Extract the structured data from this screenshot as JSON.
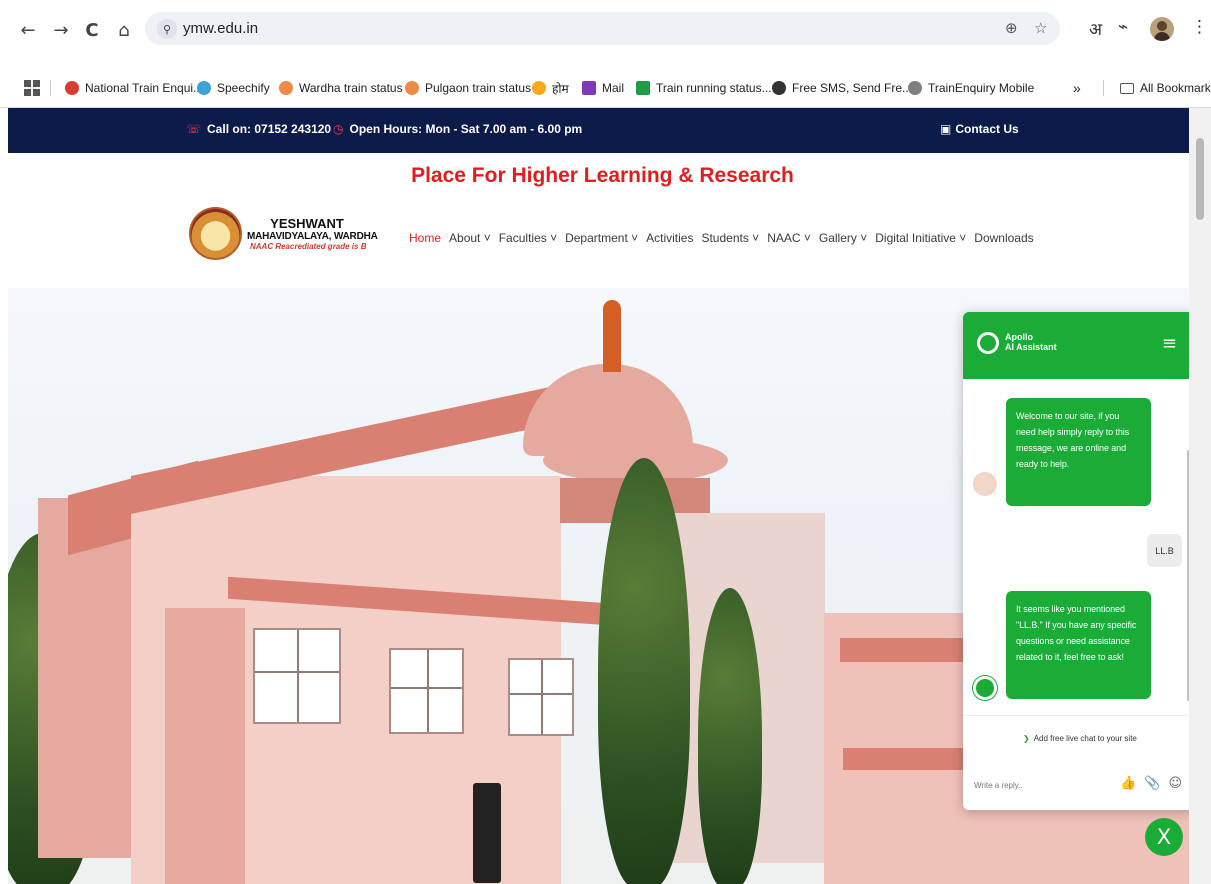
{
  "browser": {
    "url": "ymw.edu.in",
    "back_icon": "←",
    "forward_icon": "→",
    "reload_icon": "C",
    "home_icon": "⌂",
    "tune_icon": "⚲",
    "zoom_icon": "⊕",
    "star_icon": "☆",
    "translate_icon": "अ",
    "extensions_icon": "⌁",
    "menu_icon": "⋮"
  },
  "bookmarks": {
    "items": [
      {
        "label": "National Train Enqui...",
        "color": "#d63d33"
      },
      {
        "label": "Speechify",
        "color": "#3ba3d8"
      },
      {
        "label": "Wardha train status",
        "color": "#f08a46"
      },
      {
        "label": "Pulgaon train status",
        "color": "#f08a46"
      },
      {
        "label": "होम",
        "color": "#f7a81c"
      },
      {
        "label": "Mail",
        "color": "#7c3ab8"
      },
      {
        "label": "Train running status...",
        "color": "#1f9b47"
      },
      {
        "label": "Free SMS, Send Fre...",
        "color": "#333333"
      },
      {
        "label": "TrainEnquiry Mobile",
        "color": "#7e7e7e"
      }
    ],
    "more": "»",
    "all_label": "All Bookmarks"
  },
  "site": {
    "top": {
      "call": "Call on: 07152 243120",
      "hours": "Open Hours: Mon - Sat 7.00 am - 6.00 pm",
      "contact": "Contact Us"
    },
    "tagline": "Place For Higher Learning & Research",
    "logo": {
      "line1": "YESHWANT",
      "line2": "MAHAVIDYALAYA, WARDHA",
      "line3": "NAAC Reacrediated grade is B"
    },
    "nav": [
      "Home",
      "About ˅",
      "Faculties ˅",
      "Department ˅",
      "Activities",
      "Students ˅",
      "NAAC ˅",
      "Gallery ˅",
      "Digital Initiative ˅",
      "Downloads"
    ]
  },
  "chat": {
    "title_line1": "Apollo",
    "title_line2": "AI Assistant",
    "menu": "≡",
    "message1": "Welcome to our site, if you need help simply reply to this message, we are online and ready to help.",
    "user_message": "LL.B",
    "message2": "It seems like you mentioned \"LL.B.\" If you have any specific questions or need assistance related to it, feel free to ask!",
    "branding": "Add free live chat to your site",
    "placeholder": "Write a reply..",
    "actions": [
      "👍",
      "📎",
      "☺"
    ],
    "close": "X"
  }
}
